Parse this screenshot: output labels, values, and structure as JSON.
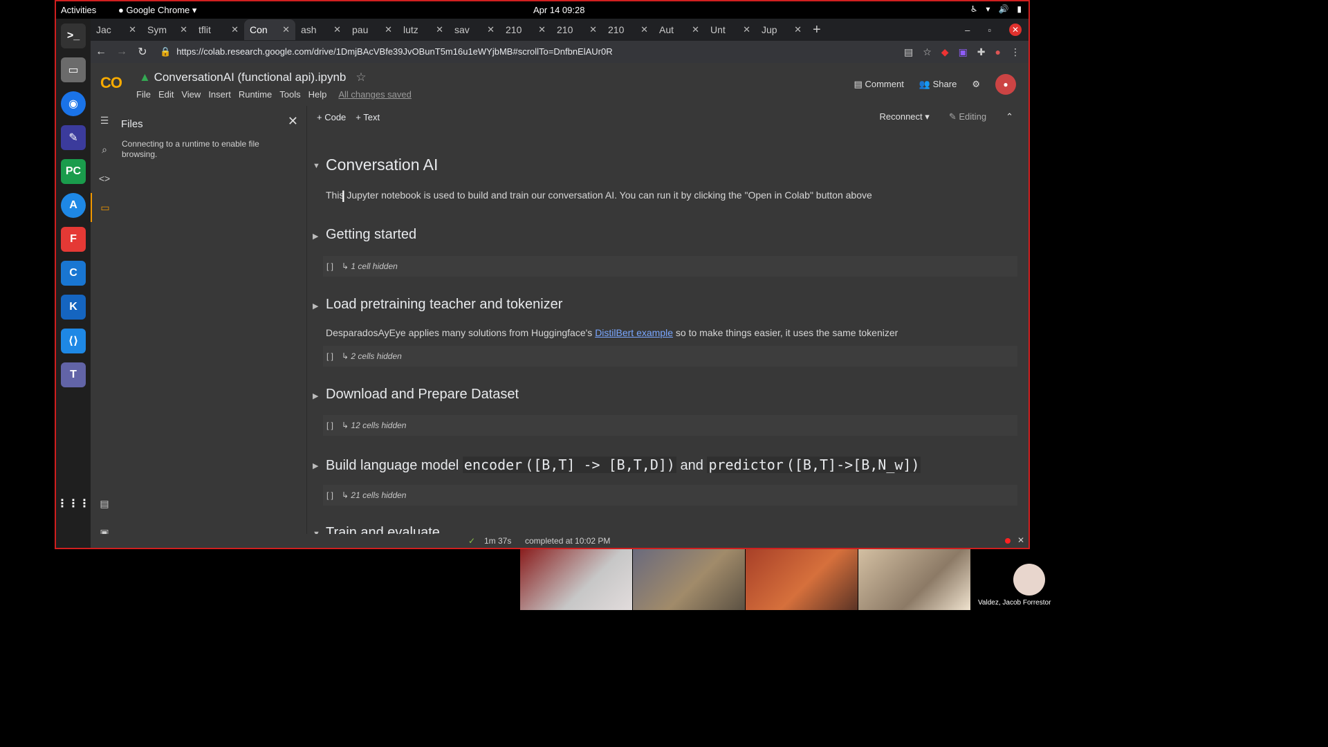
{
  "system": {
    "activities": "Activities",
    "app_name": "Google Chrome",
    "clock": "Apr 14  09:28"
  },
  "browser": {
    "tabs": [
      "Jac",
      "Sym",
      "tflit",
      "Con",
      "ash",
      "pau",
      "lutz",
      "sav",
      "210",
      "210",
      "210",
      "Aut",
      "Unt",
      "Jup"
    ],
    "url": "https://colab.research.google.com/drive/1DmjBAcVBfe39JvOBunT5m16u1eWYjbMB#scrollTo=DnfbnElAUr0R"
  },
  "colab": {
    "logo": "CO",
    "title": "ConversationAI (functional api).ipynb",
    "menu": [
      "File",
      "Edit",
      "View",
      "Insert",
      "Runtime",
      "Tools",
      "Help"
    ],
    "saved": "All changes saved",
    "comment": "Comment",
    "share": "Share",
    "code_btn": "+ Code",
    "text_btn": "+ Text",
    "reconnect": "Reconnect",
    "editing": "Editing"
  },
  "files": {
    "title": "Files",
    "message": "Connecting to a runtime to enable file browsing."
  },
  "notebook": {
    "h_conversation": "Conversation AI",
    "intro": "This Jupyter notebook is used to build and train our conversation AI. You can run it by clicking the \"Open in Colab\" button above",
    "h_getting_started": "Getting started",
    "hidden_1": "1 cell hidden",
    "h_load": "Load pretraining teacher and tokenizer",
    "load_desc_pre": "DesparadosAyEye applies many solutions from Huggingface's ",
    "load_desc_link": "DistilBert example",
    "load_desc_post": " so to make things easier, it uses the same tokenizer",
    "hidden_2": "2 cells hidden",
    "h_download": "Download and Prepare Dataset",
    "hidden_12": "12 cells hidden",
    "h_build_pre": "Build language model ",
    "h_build_code1": "encoder",
    "h_build_code2": "([B,T] -> [B,T,D])",
    "h_build_and": " and ",
    "h_build_code3": "predictor",
    "h_build_code4": "([B,T]->[B,N_w])",
    "hidden_21": "21 cells hidden",
    "h_train": "Train and evaluate"
  },
  "status": {
    "duration": "1m 37s",
    "completed": "completed at 10:02 PM"
  },
  "meeting": {
    "self_name": "Valdez, Jacob Forrestor"
  }
}
